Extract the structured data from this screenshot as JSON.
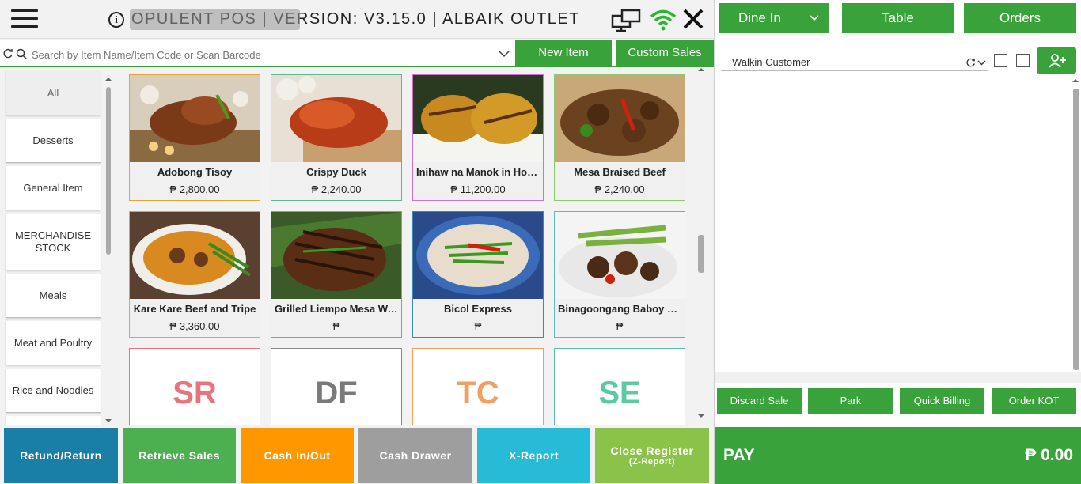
{
  "app": {
    "title": "OPULENT POS | VERSION: V3.15.0 | ALBAIK OUTLET"
  },
  "search": {
    "placeholder": "Search by Item Name/Item Code or Scan Barcode",
    "new_item_label": "New Item",
    "custom_sales_label": "Custom Sales"
  },
  "categories": [
    {
      "label": "All",
      "active": true
    },
    {
      "label": "Desserts"
    },
    {
      "label": "General Item"
    },
    {
      "label": "MERCHANDISE STOCK"
    },
    {
      "label": "Meals"
    },
    {
      "label": "Meat and Poultry"
    },
    {
      "label": "Rice and Noodles"
    }
  ],
  "items": [
    {
      "name": "Adobong Tisoy",
      "price": "₱ 2,800.00",
      "border": "#f0a030"
    },
    {
      "name": "Crispy Duck",
      "price": "₱ 2,240.00",
      "border": "#5cb98a"
    },
    {
      "name": "Inihaw na Manok in Honey",
      "price": "₱ 11,200.00",
      "border": "#d070d0"
    },
    {
      "name": "Mesa Braised Beef",
      "price": "₱ 2,240.00",
      "border": "#8acb6a"
    },
    {
      "name": "Kare Kare Beef and Tripe",
      "price": "₱ 3,360.00",
      "border": "#f0a030"
    },
    {
      "name": "Grilled Liempo Mesa Way",
      "price": "₱",
      "border": "#5cb98a"
    },
    {
      "name": "Bicol Express",
      "price": "₱",
      "border": "#3a8ab8"
    },
    {
      "name": "Binagoongang Baboy ni ...",
      "price": "₱",
      "border": "#5ab8c8"
    }
  ],
  "tiles": [
    {
      "abbr": "SR",
      "color": "#e8737a",
      "border": "#e8737a"
    },
    {
      "abbr": "DF",
      "color": "#7a7a7a",
      "border": "#888888"
    },
    {
      "abbr": "TC",
      "color": "#f0a060",
      "border": "#f0a060"
    },
    {
      "abbr": "SE",
      "color": "#5cc9a0",
      "border": "#5cb9c0"
    }
  ],
  "bottom_buttons": {
    "refund": "Refund/Return",
    "retrieve": "Retrieve Sales",
    "cash_in_out": "Cash In/Out",
    "cash_drawer": "Cash Drawer",
    "x_report": "X-Report",
    "close_register": "Close Register",
    "close_register_sub": "(Z-Report)"
  },
  "right": {
    "order_type": "Dine In",
    "table_label": "Table",
    "orders_label": "Orders",
    "customer": "Walkin Customer",
    "discard": "Discard Sale",
    "park": "Park",
    "quick_billing": "Quick Billing",
    "order_kot": "Order KOT",
    "pay_label": "PAY",
    "pay_amount": "₱ 0.00"
  },
  "colors": {
    "accent_green": "#3aa23a",
    "refund": "#1a7fa6",
    "retrieve": "#4caf50",
    "cash_in_out": "#ff9800",
    "cash_drawer": "#9e9e9e",
    "x_report": "#26bcd7",
    "close_register": "#8bc34a"
  }
}
